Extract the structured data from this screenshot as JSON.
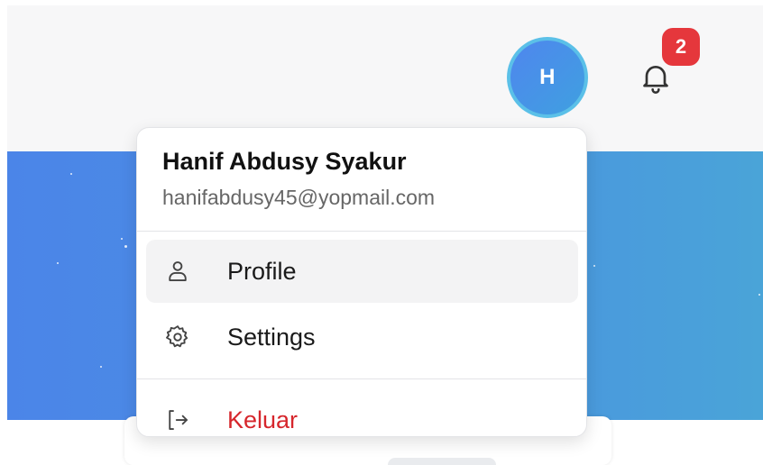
{
  "header": {
    "avatar_initial": "H",
    "notification_count": "2"
  },
  "user_menu": {
    "name": "Hanif Abdusy Syakur",
    "email": "hanifabdusy45@yopmail.com",
    "items": [
      {
        "label": "Profile",
        "icon": "user-icon"
      },
      {
        "label": "Settings",
        "icon": "gear-icon"
      },
      {
        "label": "Keluar",
        "icon": "logout-icon"
      }
    ]
  },
  "colors": {
    "avatar_ring": "#5bc0e8",
    "avatar_fill": "#4f86ee",
    "badge": "#e5373c",
    "hero": "#4b85e8",
    "logout_text": "#d6262c"
  }
}
